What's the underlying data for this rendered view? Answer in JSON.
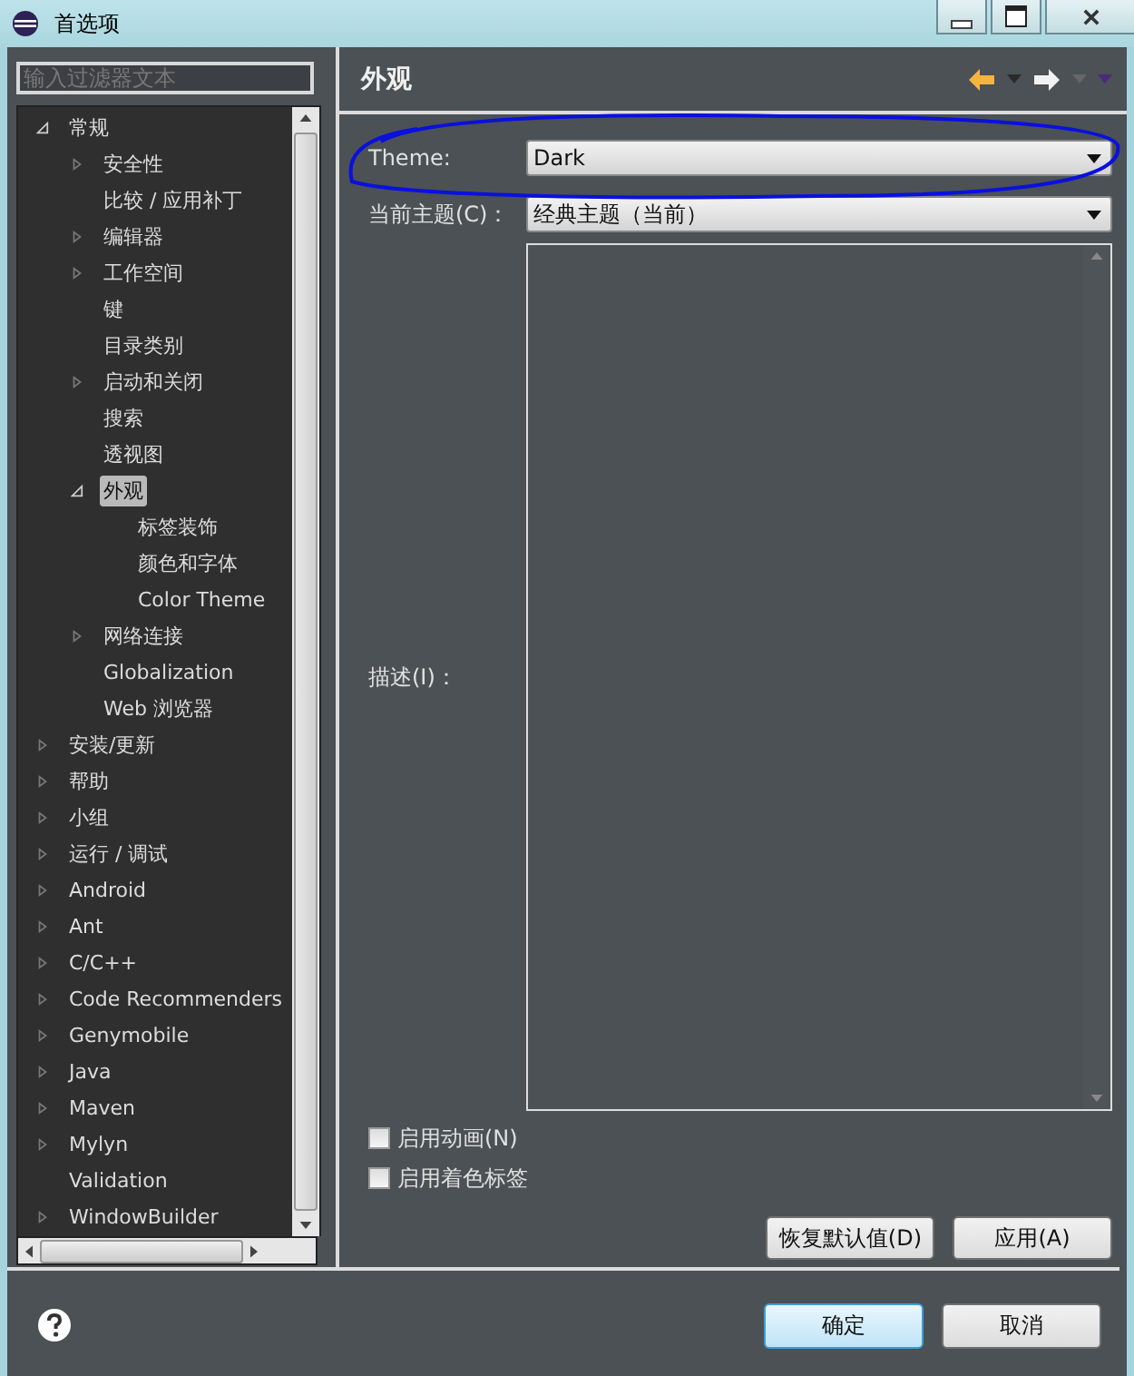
{
  "window": {
    "title": "首选项"
  },
  "filter": {
    "placeholder": "输入过滤器文本"
  },
  "tree": [
    {
      "label": "常规",
      "expanded": true,
      "selected": false,
      "children": [
        {
          "label": "安全性",
          "expanded": false,
          "selected": false
        },
        {
          "label": "比较 / 应用补丁",
          "selected": false
        },
        {
          "label": "编辑器",
          "expanded": false,
          "selected": false
        },
        {
          "label": "工作空间",
          "expanded": false,
          "selected": false
        },
        {
          "label": "键",
          "selected": false
        },
        {
          "label": "目录类别",
          "selected": false
        },
        {
          "label": "启动和关闭",
          "expanded": false,
          "selected": false
        },
        {
          "label": "搜索",
          "selected": false
        },
        {
          "label": "透视图",
          "selected": false
        },
        {
          "label": "外观",
          "expanded": true,
          "selected": true,
          "children": [
            {
              "label": "标签装饰",
              "selected": false
            },
            {
              "label": "颜色和字体",
              "selected": false
            },
            {
              "label": "Color Theme",
              "selected": false
            }
          ]
        },
        {
          "label": "网络连接",
          "expanded": false,
          "selected": false
        },
        {
          "label": "Globalization",
          "selected": false
        },
        {
          "label": "Web 浏览器",
          "selected": false
        }
      ]
    },
    {
      "label": "安装/更新",
      "expanded": false,
      "selected": false
    },
    {
      "label": "帮助",
      "expanded": false,
      "selected": false
    },
    {
      "label": "小组",
      "expanded": false,
      "selected": false
    },
    {
      "label": "运行 / 调试",
      "expanded": false,
      "selected": false
    },
    {
      "label": "Android",
      "expanded": false,
      "selected": false
    },
    {
      "label": "Ant",
      "expanded": false,
      "selected": false
    },
    {
      "label": "C/C++",
      "expanded": false,
      "selected": false
    },
    {
      "label": "Code Recommenders",
      "expanded": false,
      "selected": false
    },
    {
      "label": "Genymobile",
      "expanded": false,
      "selected": false
    },
    {
      "label": "Java",
      "expanded": false,
      "selected": false
    },
    {
      "label": "Maven",
      "expanded": false,
      "selected": false
    },
    {
      "label": "Mylyn",
      "expanded": false,
      "selected": false
    },
    {
      "label": "Validation",
      "selected": false
    },
    {
      "label": "WindowBuilder",
      "expanded": false,
      "selected": false
    }
  ],
  "page": {
    "title": "外观",
    "theme": {
      "label": "Theme:",
      "value": "Dark"
    },
    "current_theme": {
      "label": "当前主题(C)：",
      "value": "经典主题（当前）"
    },
    "description": {
      "label": "描述(I)："
    },
    "checkboxes": [
      {
        "label": "启用动画(N)",
        "checked": false
      },
      {
        "label": "启用着色标签",
        "checked": false
      }
    ],
    "buttons": [
      "恢复默认值(D)",
      "应用(A)"
    ]
  },
  "annotations": [
    {
      "kind": "ellipse"
    }
  ],
  "footer": {
    "buttons": [
      {
        "label": "确定",
        "selected": true
      },
      {
        "label": "取消",
        "selected": false
      }
    ]
  }
}
